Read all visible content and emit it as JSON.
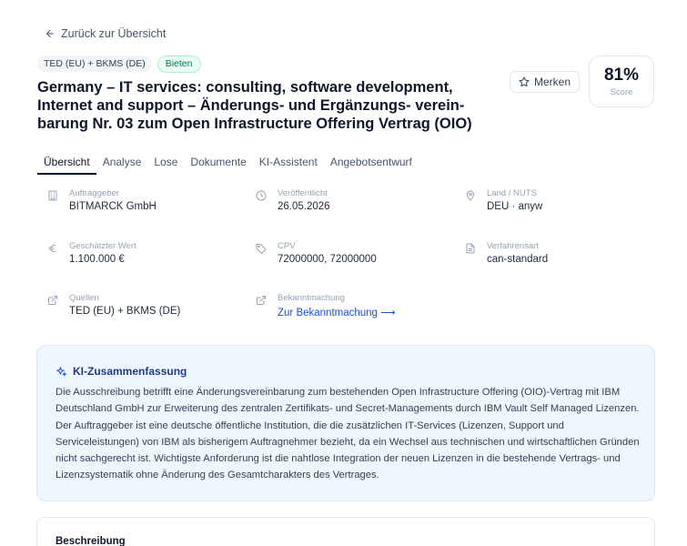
{
  "back_link": {
    "label": "Zurück zur Übersicht",
    "icon": "arrow-left-icon"
  },
  "badges": {
    "source": "TED (EU) + BKMS (DE)",
    "status": "Bieten"
  },
  "title": "Germany – IT services: consulting, software development, Internet and support – Änderungs- und Ergänzungs- verein-barung Nr. 03 zum Open Infrastructure Offering Vertrag (OIO)",
  "bookmark": {
    "label": "Merken",
    "icon": "star-icon"
  },
  "score": {
    "value": "81%",
    "label": "Score"
  },
  "tabs": [
    {
      "label": "Übersicht",
      "active": true
    },
    {
      "label": "Analyse"
    },
    {
      "label": "Lose"
    },
    {
      "label": "Dokumente"
    },
    {
      "label": "KI-Assistent"
    },
    {
      "label": "Angebotsentwurf"
    }
  ],
  "meta": {
    "auftraggeber": {
      "label": "Auftraggeber",
      "value": "BITMARCK GmbH",
      "icon": "building-icon"
    },
    "veroeffentlicht": {
      "label": "Veröffentlicht",
      "value": "26.05.2026",
      "icon": "clock-icon"
    },
    "land": {
      "label": "Land / NUTS",
      "value": "DEU · anyw",
      "icon": "map-pin-icon"
    },
    "wert": {
      "label": "Geschätzter Wert",
      "value": "1.100.000 €",
      "icon": "euro-icon"
    },
    "cpv": {
      "label": "CPV",
      "value": "72000000, 72000000",
      "icon": "tag-icon"
    },
    "verfahrensart": {
      "label": "Verfahrensart",
      "value": "can-standard",
      "icon": "file-icon"
    },
    "quellen": {
      "label": "Quellen",
      "value": "TED (EU) + BKMS (DE)",
      "icon": "external-link-icon"
    },
    "bekanntmachung": {
      "label": "Bekanntmachung",
      "value": "Zur Bekanntmachung ⟶",
      "icon": "external-link-icon"
    }
  },
  "ai_summary": {
    "title": "KI-Zusammenfassung",
    "icon": "sparkles-icon",
    "text": "Die Ausschreibung betrifft eine Änderungsvereinbarung zum bestehenden Open Infrastructure Offering (OIO)-Vertrag mit IBM Deutschland GmbH zur Erweiterung des zentralen Zertifikats- und Secret-Managements durch IBM Vault Self Managed Lizenzen. Der Auftraggeber ist eine deutsche öffentliche Institution, die die zusätzlichen IT-Services (Lizenzen, Support und Serviceleistungen) von IBM als bisherigem Auftragnehmer bezieht, da ein Wechsel aus technischen und wirtschaftlichen Gründen nicht sachgerecht ist. Wichtigste Anforderung ist die nahtlose Integration der neuen Lizenzen in die bestehende Vertrags- und Lizenzsystematik ohne Änderung des Gesamtcharakters des Vertrages."
  },
  "description": {
    "title": "Beschreibung"
  },
  "colors": {
    "accent_link": "#1d4ed8",
    "status_green": "#047857",
    "ai_bg": "#f0f6fd",
    "ai_title": "#1e3a8a"
  }
}
